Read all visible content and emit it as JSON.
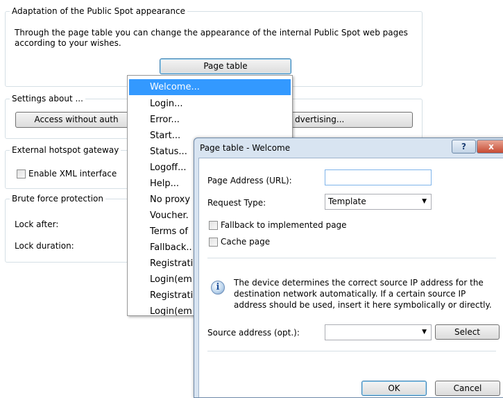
{
  "adaptation": {
    "title": "Adaptation of the Public Spot appearance",
    "description_line1": "Through the page table you can change the appearance of the internal Public Spot web pages",
    "description_line2": "according to your wishes.",
    "page_table_button": "Page table"
  },
  "settings": {
    "title": "Settings about ...",
    "access_button": "Access without auth",
    "advertising_button": "dvertising..."
  },
  "gateway": {
    "title": "External hotspot gateway",
    "enable_xml_label": "Enable XML interface"
  },
  "brute_force": {
    "title": "Brute force protection",
    "lock_after_label": "Lock after:",
    "lock_duration_label": "Lock duration:"
  },
  "menu": {
    "items": [
      "Welcome...",
      "Login...",
      "Error...",
      "Start...",
      "Status...",
      "Logoff...",
      "Help...",
      "No proxy",
      "Voucher.",
      "Terms of",
      "Fallback..",
      "Registrati",
      "Login(em",
      "Registrati",
      "Login(em"
    ],
    "selected_index": 0
  },
  "dialog": {
    "title": "Page table - Welcome",
    "help_glyph": "?",
    "close_glyph": "x",
    "page_address_label": "Page Address (URL):",
    "page_address_value": "",
    "request_type_label": "Request Type:",
    "request_type_value": "Template",
    "fallback_label": "Fallback to implemented page",
    "cache_label": "Cache page",
    "info_icon_glyph": "i",
    "info_line1": "The device determines the correct source IP address for the",
    "info_line2": "destination network automatically. If a certain source IP",
    "info_line3": "address should be used, insert it here symbolically or directly.",
    "source_address_label": "Source address (opt.):",
    "source_address_value": "",
    "select_button": "Select",
    "ok_button": "OK",
    "cancel_button": "Cancel"
  }
}
